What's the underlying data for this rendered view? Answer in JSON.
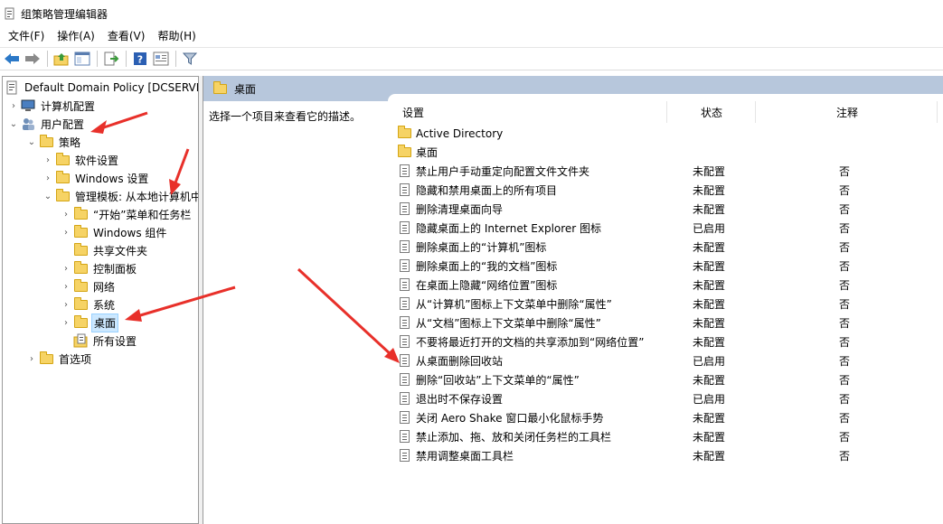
{
  "window": {
    "title": "组策略管理编辑器"
  },
  "menu": [
    "文件(F)",
    "操作(A)",
    "查看(V)",
    "帮助(H)"
  ],
  "toolbar": {
    "buttons": [
      "back-icon",
      "forward-icon",
      "up-folder-icon",
      "show-hide-tree-icon",
      "export-list-icon",
      "help-icon",
      "properties-view-icon",
      "filter-icon"
    ]
  },
  "tree": [
    {
      "label": "Default Domain Policy [DCSERVE",
      "icon": "policy-icon"
    },
    {
      "label": "计算机配置",
      "icon": "computer-icon"
    },
    {
      "label": "用户配置",
      "icon": "users-icon"
    },
    {
      "label": "策略",
      "icon": "folder-icon"
    },
    {
      "label": "软件设置",
      "icon": "folder-icon"
    },
    {
      "label": "Windows 设置",
      "icon": "folder-icon"
    },
    {
      "label": "管理模板: 从本地计算机中",
      "icon": "folder-icon"
    },
    {
      "label": "“开始”菜单和任务栏",
      "icon": "folder-icon"
    },
    {
      "label": "Windows 组件",
      "icon": "folder-icon"
    },
    {
      "label": "共享文件夹",
      "icon": "folder-icon"
    },
    {
      "label": "控制面板",
      "icon": "folder-icon"
    },
    {
      "label": "网络",
      "icon": "folder-icon"
    },
    {
      "label": "系统",
      "icon": "folder-icon"
    },
    {
      "label": "桌面",
      "icon": "folder-icon"
    },
    {
      "label": "所有设置",
      "icon": "all-settings-icon"
    },
    {
      "label": "首选项",
      "icon": "folder-icon"
    }
  ],
  "right": {
    "header": "桌面",
    "description": "选择一个项目来查看它的描述。",
    "columns": {
      "setting": "设置",
      "state": "状态",
      "comment": "注释"
    },
    "folders": [
      "Active Directory",
      "桌面"
    ],
    "settings": [
      {
        "name": "禁止用户手动重定向配置文件文件夹",
        "state": "未配置",
        "comment": "否"
      },
      {
        "name": "隐藏和禁用桌面上的所有项目",
        "state": "未配置",
        "comment": "否"
      },
      {
        "name": "删除清理桌面向导",
        "state": "未配置",
        "comment": "否"
      },
      {
        "name": "隐藏桌面上的 Internet Explorer 图标",
        "state": "已启用",
        "comment": "否"
      },
      {
        "name": "删除桌面上的“计算机”图标",
        "state": "未配置",
        "comment": "否"
      },
      {
        "name": "删除桌面上的“我的文档”图标",
        "state": "未配置",
        "comment": "否"
      },
      {
        "name": "在桌面上隐藏“网络位置”图标",
        "state": "未配置",
        "comment": "否"
      },
      {
        "name": "从“计算机”图标上下文菜单中删除“属性”",
        "state": "未配置",
        "comment": "否"
      },
      {
        "name": "从“文档”图标上下文菜单中删除“属性”",
        "state": "未配置",
        "comment": "否"
      },
      {
        "name": "不要将最近打开的文档的共享添加到“网络位置”",
        "state": "未配置",
        "comment": "否"
      },
      {
        "name": "从桌面删除回收站",
        "state": "已启用",
        "comment": "否"
      },
      {
        "name": "删除“回收站”上下文菜单的“属性”",
        "state": "未配置",
        "comment": "否"
      },
      {
        "name": "退出时不保存设置",
        "state": "已启用",
        "comment": "否"
      },
      {
        "name": "关闭 Aero Shake 窗口最小化鼠标手势",
        "state": "未配置",
        "comment": "否"
      },
      {
        "name": "禁止添加、拖、放和关闭任务栏的工具栏",
        "state": "未配置",
        "comment": "否"
      },
      {
        "name": "禁用调整桌面工具栏",
        "state": "未配置",
        "comment": "否"
      }
    ]
  },
  "colors": {
    "header_band": "#b7c7dc",
    "selection": "#cce8ff",
    "annotation_arrow": "#e8302a"
  }
}
